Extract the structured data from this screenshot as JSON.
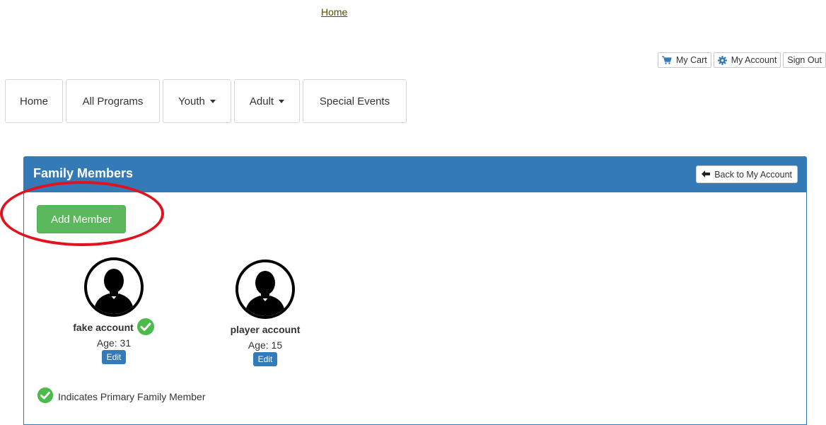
{
  "top": {
    "home_link": "Home"
  },
  "utility": {
    "cart": {
      "label": "My Cart",
      "icon": "cart-icon"
    },
    "account": {
      "label": "My Account",
      "icon": "gear-icon"
    },
    "signout": {
      "label": "Sign Out"
    }
  },
  "nav": [
    {
      "label": "Home",
      "dropdown": false
    },
    {
      "label": "All Programs",
      "dropdown": false
    },
    {
      "label": "Youth",
      "dropdown": true
    },
    {
      "label": "Adult",
      "dropdown": true
    },
    {
      "label": "Special Events",
      "dropdown": false
    }
  ],
  "panel": {
    "title": "Family Members",
    "back_label": "Back to My Account",
    "add_label": "Add Member",
    "members": [
      {
        "name": "fake account",
        "age": "Age: 31",
        "primary": true,
        "edit_label": "Edit"
      },
      {
        "name": "player account",
        "age": "Age: 15",
        "primary": false,
        "edit_label": "Edit"
      }
    ],
    "legend": "Indicates Primary Family Member"
  },
  "colors": {
    "primary": "#337ab7",
    "success": "#5cb85c",
    "check": "#4cbb4c",
    "annotation": "#e0141e"
  }
}
